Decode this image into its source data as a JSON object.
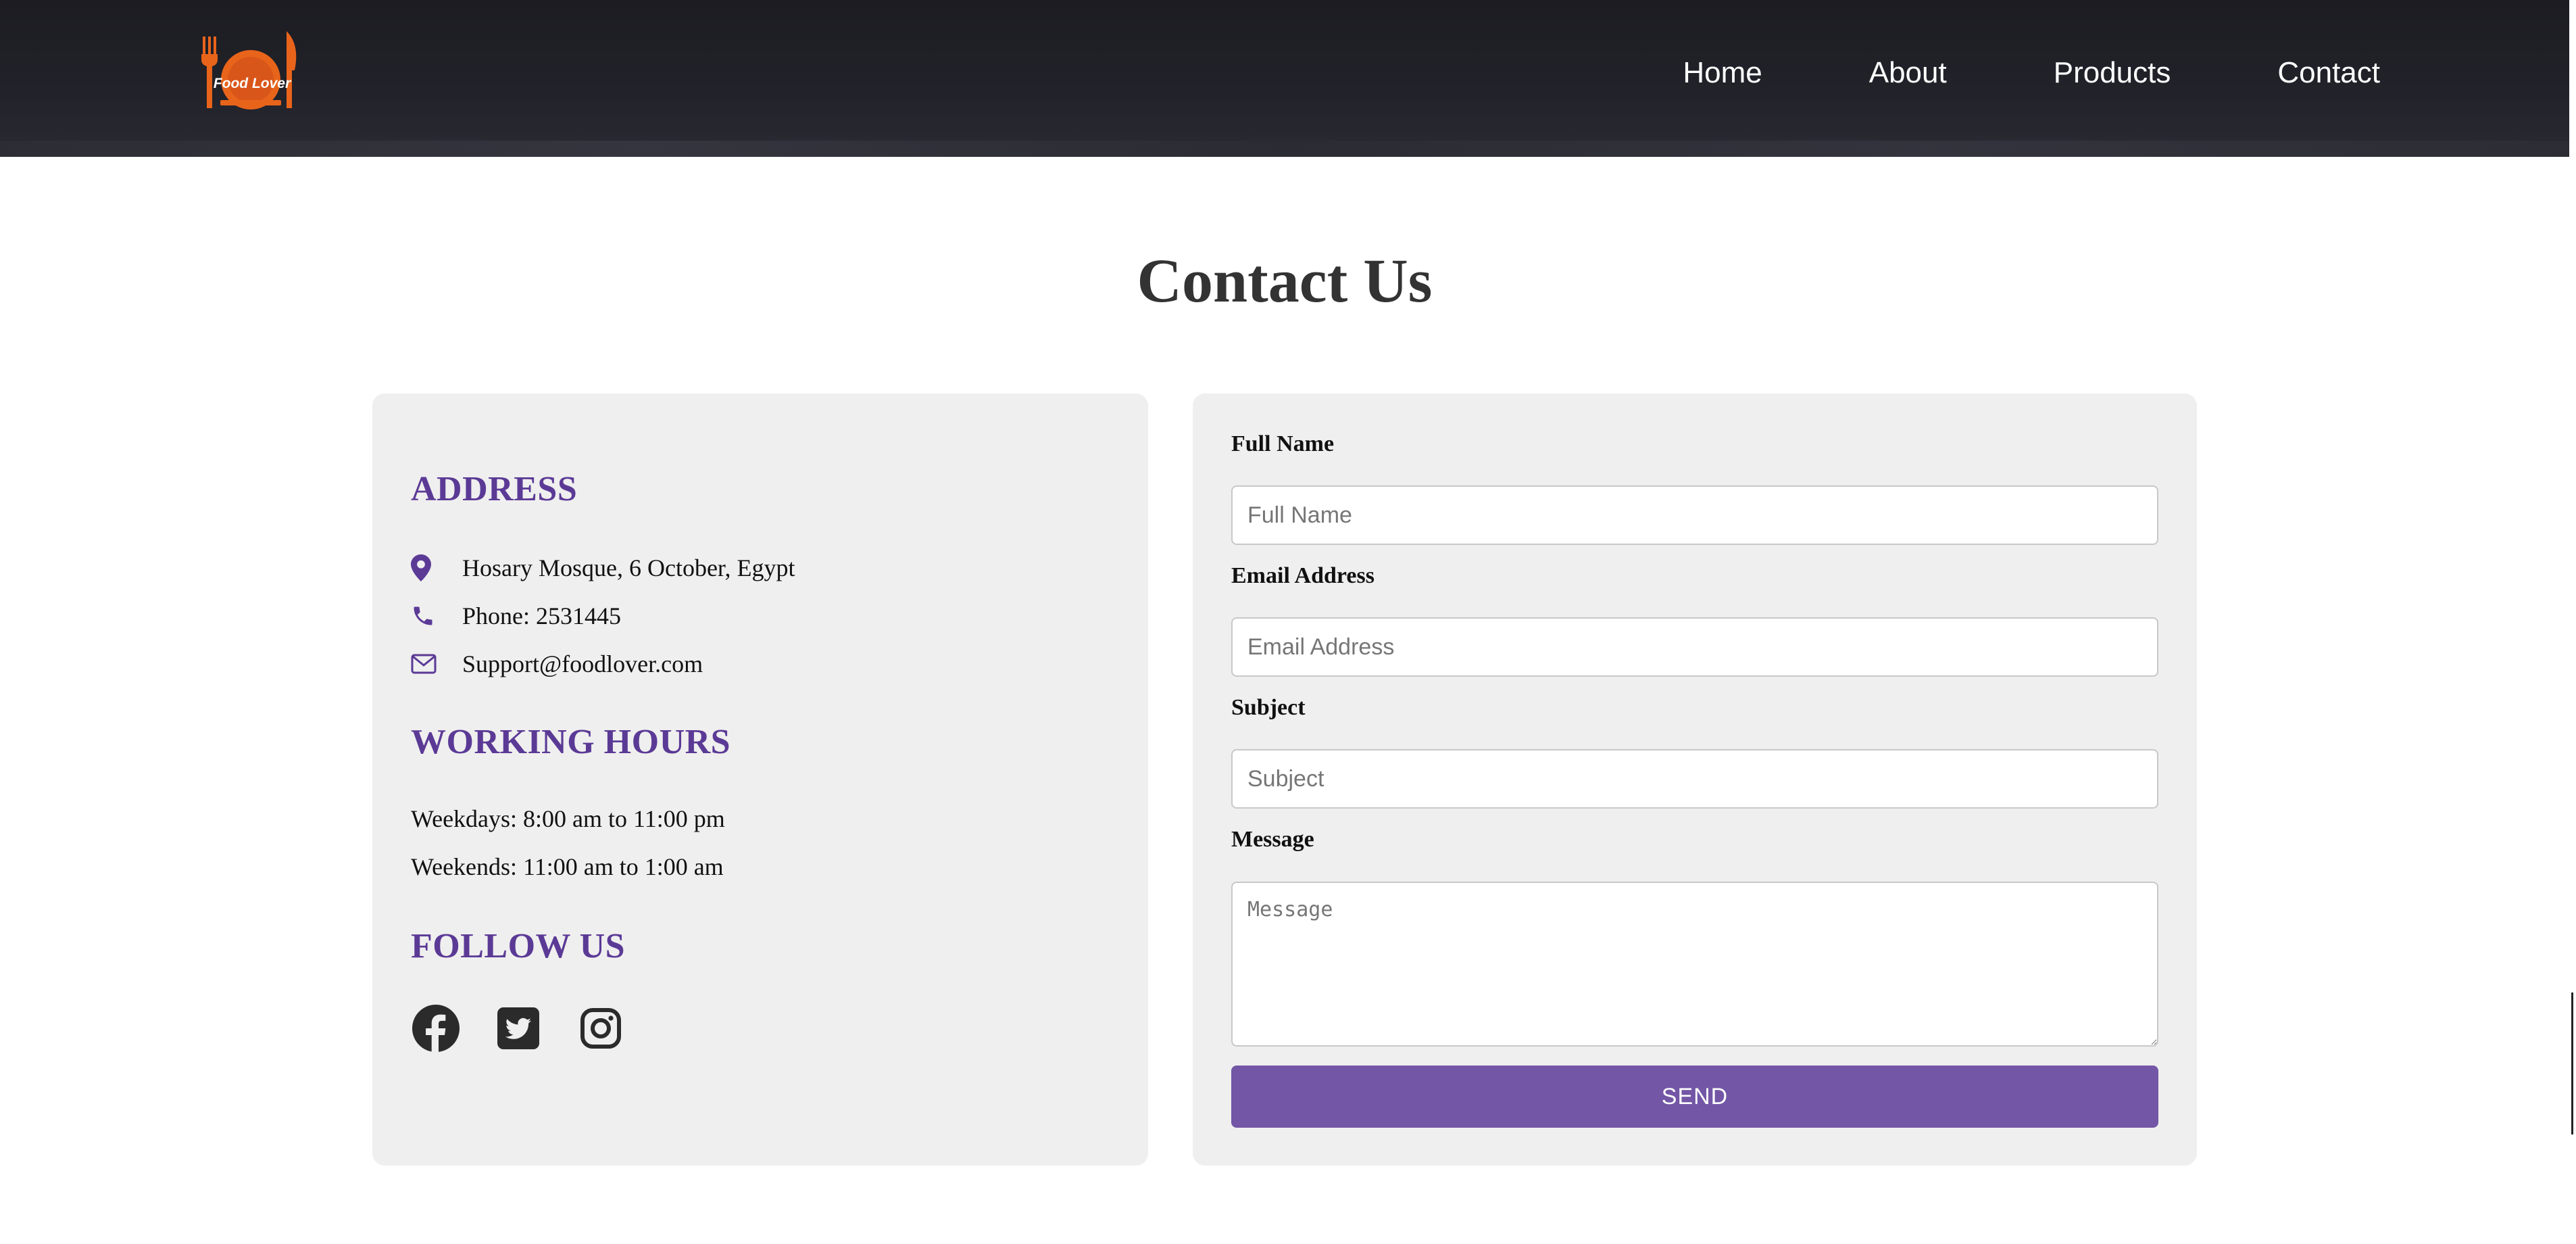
{
  "header": {
    "logo_text": "Food Lover",
    "nav": [
      {
        "label": "Home"
      },
      {
        "label": "About"
      },
      {
        "label": "Products"
      },
      {
        "label": "Contact"
      }
    ]
  },
  "page": {
    "title": "Contact Us"
  },
  "info": {
    "address_heading": "ADDRESS",
    "address": "Hosary Mosque, 6 October, Egypt",
    "phone": "Phone: 2531445",
    "email": "Support@foodlover.com",
    "hours_heading": "WORKING HOURS",
    "weekdays": "Weekdays: 8:00 am to 11:00 pm",
    "weekends": "Weekends: 11:00 am to 1:00 am",
    "follow_heading": "FOLLOW US",
    "social": [
      "facebook-icon",
      "twitter-icon",
      "instagram-icon"
    ]
  },
  "form": {
    "full_name_label": "Full Name",
    "full_name_placeholder": "Full Name",
    "email_label": "Email Address",
    "email_placeholder": "Email Address",
    "subject_label": "Subject",
    "subject_placeholder": "Subject",
    "message_label": "Message",
    "message_placeholder": "Message",
    "send_label": "SEND"
  },
  "colors": {
    "accent": "#5b3a96",
    "button": "#7356a6",
    "header_bg": "#1c1c22",
    "logo": "#e8641a",
    "card_bg": "#efefef"
  }
}
